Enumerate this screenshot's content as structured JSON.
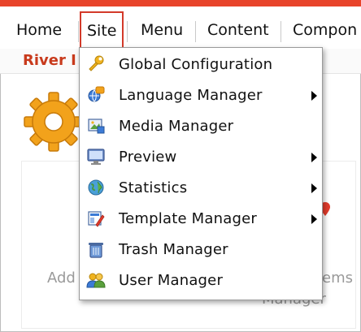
{
  "menubar": {
    "items": [
      {
        "label": "Home"
      },
      {
        "label": "Site"
      },
      {
        "label": "Menu"
      },
      {
        "label": "Content"
      },
      {
        "label": "Compon"
      }
    ]
  },
  "site_name": "River I",
  "background": {
    "left_label": "Add",
    "right_label_line1": "ems",
    "right_label_line2": "Manager"
  },
  "site_menu": {
    "items": [
      {
        "label": "Global Configuration",
        "icon": "wrench-icon",
        "has_submenu": false
      },
      {
        "label": "Language Manager",
        "icon": "language-icon",
        "has_submenu": true
      },
      {
        "label": "Media Manager",
        "icon": "media-icon",
        "has_submenu": false
      },
      {
        "label": "Preview",
        "icon": "monitor-icon",
        "has_submenu": true
      },
      {
        "label": "Statistics",
        "icon": "globe-icon",
        "has_submenu": true
      },
      {
        "label": "Template Manager",
        "icon": "template-icon",
        "has_submenu": true
      },
      {
        "label": "Trash Manager",
        "icon": "trash-icon",
        "has_submenu": false
      },
      {
        "label": "User Manager",
        "icon": "users-icon",
        "has_submenu": false
      }
    ]
  },
  "colors": {
    "accent": "#e8442a",
    "active_border": "#d33a2a",
    "site_name": "#c83a1c"
  }
}
